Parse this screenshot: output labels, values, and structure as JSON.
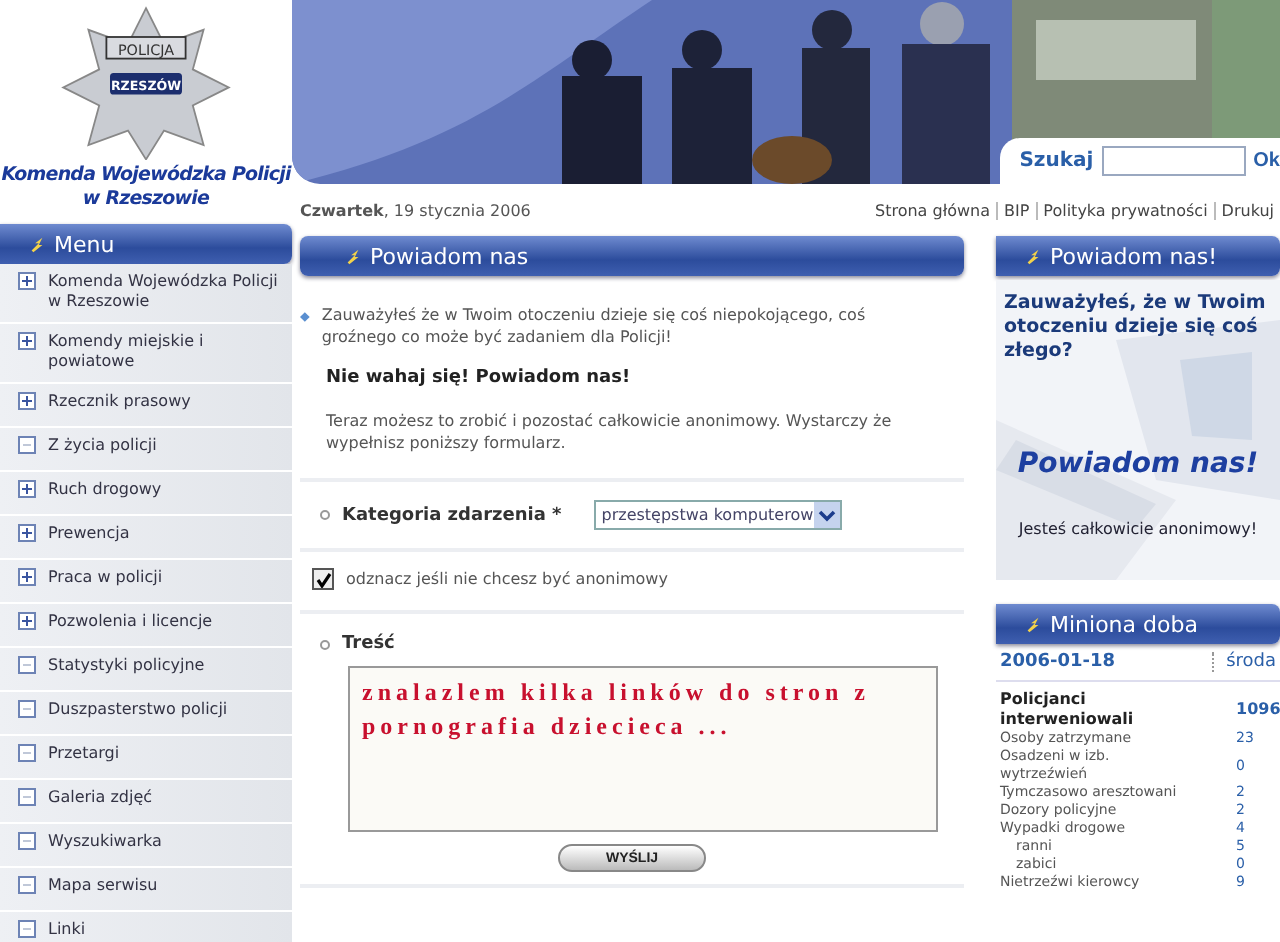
{
  "logo": {
    "badge_top": "POLICJA",
    "badge_bottom": "RZESZÓW",
    "title": "Komenda Wojewódzka Policji w Rzeszowie"
  },
  "search": {
    "label": "Szukaj",
    "button": "Ok"
  },
  "date": {
    "day": "Czwartek",
    "rest": ", 19 stycznia 2006"
  },
  "top_links": [
    "Strona główna",
    "BIP",
    "Polityka prywatności",
    "Drukuj"
  ],
  "menu": {
    "title": "Menu",
    "items": [
      {
        "label": "Komenda Wojewódzka Policji w Rzeszowie",
        "expandable": true
      },
      {
        "label": "Komendy miejskie i powiatowe",
        "expandable": true
      },
      {
        "label": "Rzecznik prasowy",
        "expandable": true
      },
      {
        "label": "Z życia policji",
        "expandable": false
      },
      {
        "label": "Ruch drogowy",
        "expandable": true
      },
      {
        "label": "Prewencja",
        "expandable": true
      },
      {
        "label": "Praca w policji",
        "expandable": true
      },
      {
        "label": "Pozwolenia i licencje",
        "expandable": true
      },
      {
        "label": "Statystyki policyjne",
        "expandable": false
      },
      {
        "label": "Duszpasterstwo policji",
        "expandable": false
      },
      {
        "label": "Przetargi",
        "expandable": false
      },
      {
        "label": "Galeria zdjęć",
        "expandable": false
      },
      {
        "label": "Wyszukiwarka",
        "expandable": false
      },
      {
        "label": "Mapa serwisu",
        "expandable": false
      },
      {
        "label": "Linki",
        "expandable": false
      }
    ]
  },
  "main": {
    "title": "Powiadom nas",
    "intro": "Zauważyłeś że w Twoim otoczeniu dzieje się coś niepokojącego, coś groźnego co może być zadaniem dla Policji!",
    "headline": "Nie wahaj się! Powiadom nas!",
    "note": "Teraz możesz to zrobić i pozostać całkowicie anonimowy. Wystarczy że wypełnisz poniższy formularz.",
    "category": {
      "label": "Kategoria zdarzenia *",
      "value": "przestępstwa komputerow"
    },
    "anonymous": {
      "label": "odznacz jeśli nie chcesz być anonimowy",
      "checked": true
    },
    "content": {
      "label": "Treść",
      "value": "znalazlem kilka linków do stron z pornografia dziecieca ..."
    },
    "submit": "WYŚLIJ"
  },
  "promo": {
    "title": "Powiadom nas!",
    "question": "Zauważyłeś, że w Twoim otoczeniu dzieje się coś złego?",
    "slogan": "Powiadom nas!",
    "footer": "Jesteś całkowicie anonimowy!"
  },
  "stats": {
    "title": "Miniona doba",
    "date": "2006-01-18",
    "weekday": "środa",
    "rows": [
      {
        "label": "Policjanci interweniowali",
        "value": "1096",
        "kind": "total"
      },
      {
        "label": "Osoby zatrzymane",
        "value": "23",
        "kind": "item"
      },
      {
        "label": "Osadzeni w izb. wytrzeźwień",
        "value": "0",
        "kind": "item"
      },
      {
        "label": "Tymczasowo aresztowani",
        "value": "2",
        "kind": "item"
      },
      {
        "label": "Dozory policyjne",
        "value": "2",
        "kind": "item"
      },
      {
        "label": "Wypadki drogowe",
        "value": "4",
        "kind": "item"
      },
      {
        "label": "ranni",
        "value": "5",
        "kind": "sub"
      },
      {
        "label": "zabici",
        "value": "0",
        "kind": "sub"
      },
      {
        "label": "Nietrzeźwi kierowcy",
        "value": "9",
        "kind": "item"
      }
    ]
  }
}
